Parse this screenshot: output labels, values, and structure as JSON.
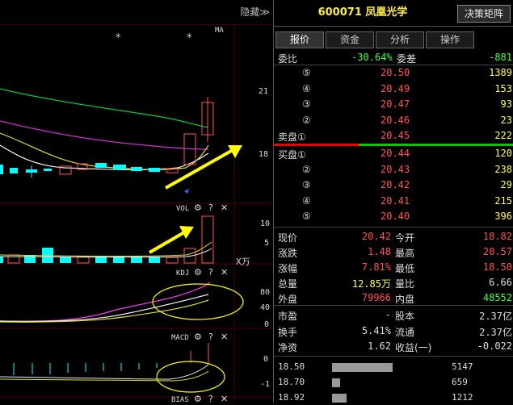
{
  "left_panel": {
    "hide_label": "隐藏≫",
    "ma_label": "MA",
    "price_ticks": [
      "21",
      "18"
    ],
    "vol_label": "VOL",
    "vol_ticks": [
      "10",
      "5"
    ],
    "vol_unit": "X万",
    "kdj_label": "KDJ",
    "kdj_ticks": [
      "80",
      "40",
      "0"
    ],
    "macd_label": "MACD",
    "macd_ticks": [
      "0",
      "-1"
    ],
    "bias_label": "BIAS",
    "gear_icon": "⚙",
    "help_icon": "?",
    "close_icon": "✕",
    "star": "*"
  },
  "quote": {
    "title": "600071 凤凰光学",
    "decision_button": "决策矩阵",
    "tabs": [
      "报价",
      "资金",
      "分析",
      "操作"
    ],
    "weibi_label": "委比",
    "weibi_value": "-30.64%",
    "weicha_label": "委差",
    "weicha_value": "-881",
    "sell": [
      {
        "label": "⑤",
        "price": "20.50",
        "vol": "1389"
      },
      {
        "label": "④",
        "price": "20.49",
        "vol": "153"
      },
      {
        "label": "③",
        "price": "20.47",
        "vol": "93"
      },
      {
        "label": "②",
        "price": "20.46",
        "vol": "23"
      },
      {
        "label": "卖盘①",
        "price": "20.45",
        "vol": "222"
      }
    ],
    "buy": [
      {
        "label": "买盘①",
        "price": "20.44",
        "vol": "120"
      },
      {
        "label": "②",
        "price": "20.43",
        "vol": "238"
      },
      {
        "label": "③",
        "price": "20.42",
        "vol": "29"
      },
      {
        "label": "④",
        "price": "20.41",
        "vol": "215"
      },
      {
        "label": "⑤",
        "price": "20.40",
        "vol": "396"
      }
    ],
    "stats": [
      {
        "l1": "现价",
        "v1": "20.42",
        "c1": "red",
        "l2": "今开",
        "v2": "18.82",
        "c2": "red"
      },
      {
        "l1": "涨跌",
        "v1": "1.48",
        "c1": "red",
        "l2": "最高",
        "v2": "20.57",
        "c2": "red"
      },
      {
        "l1": "涨幅",
        "v1": "7.81%",
        "c1": "red",
        "l2": "最低",
        "v2": "18.50",
        "c2": "red"
      },
      {
        "l1": "总量",
        "v1": "12.85万",
        "c1": "yellow",
        "l2": "量比",
        "v2": "6.66",
        "c2": "white"
      },
      {
        "l1": "外盘",
        "v1": "79966",
        "c1": "red",
        "l2": "内盘",
        "v2": "48552",
        "c2": "green"
      }
    ],
    "stats2": [
      {
        "l1": "市盈",
        "v1": "-",
        "l2": "股本",
        "v2": "2.37亿"
      },
      {
        "l1": "换手",
        "v1": "5.41%",
        "l2": "流通",
        "v2": "2.37亿"
      },
      {
        "l1": "净资",
        "v1": "1.62",
        "l2": "收益(一)",
        "v2": "-0.022"
      }
    ],
    "depth": [
      {
        "price": "18.50",
        "vol": "5147",
        "frac": 1.0
      },
      {
        "price": "18.70",
        "vol": "659",
        "frac": 0.13
      },
      {
        "price": "18.92",
        "vol": "1212",
        "frac": 0.24
      }
    ]
  },
  "colors": {
    "up": "#ff5555",
    "down": "#00ffff",
    "accent": "#ffff55"
  }
}
